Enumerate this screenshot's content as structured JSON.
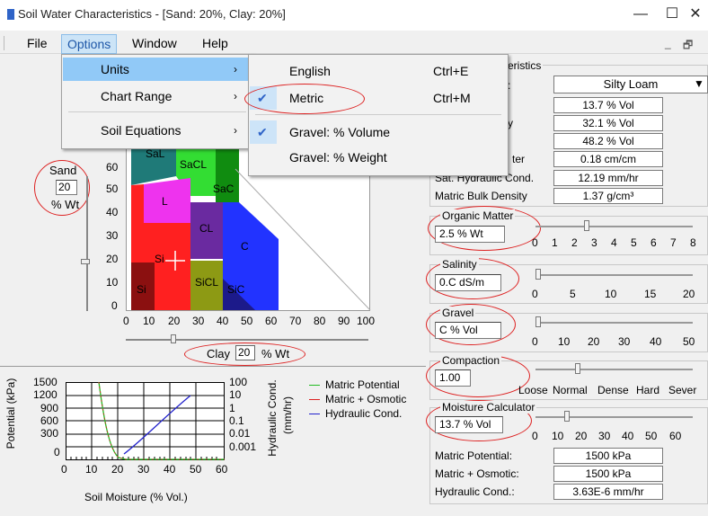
{
  "window": {
    "title": "Soil Water Characteristics  - [Sand: 20%, Clay: 20%]",
    "minimize": "—",
    "maximize": "☐",
    "close": "✕"
  },
  "menubar": {
    "items": [
      "File",
      "Options",
      "Window",
      "Help"
    ],
    "mdi_minimize": "_",
    "mdi_restore": "🗗"
  },
  "options_menu": {
    "items": [
      {
        "label": "Units",
        "arrow": "›"
      },
      {
        "label": "Chart Range",
        "arrow": "›"
      },
      {
        "label": "Soil Equations",
        "arrow": "›"
      }
    ]
  },
  "units_submenu": {
    "items": [
      {
        "label": "English",
        "shortcut": "Ctrl+E",
        "checked": false
      },
      {
        "label": "Metric",
        "shortcut": "Ctrl+M",
        "checked": true
      },
      {
        "label": "Gravel: % Volume",
        "shortcut": "",
        "checked": true
      },
      {
        "label": "Gravel: % Weight",
        "shortcut": "",
        "checked": false
      }
    ],
    "check_mark": "✔"
  },
  "triangle": {
    "sand_label": "Sand",
    "sand_value": "20",
    "sand_unit": "% Wt",
    "y_ticks": [
      "60",
      "50",
      "40",
      "30",
      "20",
      "10",
      "0"
    ],
    "x_ticks": [
      "0",
      "10",
      "20",
      "30",
      "40",
      "50",
      "60",
      "70",
      "80",
      "90",
      "100"
    ],
    "clay_label": "Clay",
    "clay_value": "20",
    "clay_unit": "% Wt",
    "region_labels": [
      "SaL",
      "SaCL",
      "L",
      "SaC",
      "CL",
      "C",
      "Si",
      "SiCL",
      "Si",
      "SiC"
    ],
    "region_colors": {
      "SaL": "#1f7a78",
      "SaCL": "#33dd33",
      "SaC": "#108c10",
      "L": "#ee33ee",
      "CL": "#6a2aa0",
      "C": "#2233ff",
      "Si": "#ff2020",
      "SiCL": "#8d9a14",
      "SiC": "#1c1a8a",
      "SiLow": "#8b1010"
    }
  },
  "properties": {
    "heading_fragment": "eristics",
    "texture": "Silty Loam",
    "rows": [
      {
        "label": "",
        "value": "13.7 % Vol"
      },
      {
        "label": "",
        "value": "32.1 % Vol"
      },
      {
        "label": "",
        "value": "48.2 % Vol"
      },
      {
        "label": "ter",
        "value": "0.18 cm/cm"
      },
      {
        "label": "Sat. Hydraulic Cond.",
        "value": "12.19 mm/hr"
      },
      {
        "label": "Matric Bulk Density",
        "value": "1.37 g/cm³"
      }
    ],
    "partial_labels": [
      ":",
      "y"
    ]
  },
  "organic": {
    "title": "Organic Matter",
    "value": "2.5 % Wt",
    "ticks": [
      "0",
      "1",
      "2",
      "3",
      "4",
      "5",
      "6",
      "7",
      "8"
    ]
  },
  "salinity": {
    "title": "Salinity",
    "value": "0.C dS/m",
    "ticks": [
      "0",
      "5",
      "10",
      "15",
      "20"
    ]
  },
  "gravel": {
    "title": "Gravel",
    "value": "C % Vol",
    "ticks": [
      "0",
      "10",
      "20",
      "30",
      "40",
      "50"
    ]
  },
  "compaction": {
    "title": "Compaction",
    "value": "1.00",
    "ticks": [
      "Loose",
      "Normal",
      "Dense",
      "Hard",
      "Sever"
    ]
  },
  "moisture": {
    "title": "Moisture Calculator",
    "value": "13.7 % Vol",
    "ticks": [
      "0",
      "10",
      "20",
      "30",
      "40",
      "50",
      "60"
    ],
    "results": [
      {
        "label": "Matric Potential:",
        "value": "1500 kPa"
      },
      {
        "label": "Matric + Osmotic:",
        "value": "1500 kPa"
      },
      {
        "label": "Hydraulic Cond.:",
        "value": "3.63E-6 mm/hr"
      }
    ]
  },
  "mini_chart": {
    "y_left_label": "Potential (kPa)",
    "y_left_ticks": [
      "1500",
      "1200",
      "900",
      "600",
      "300",
      "0"
    ],
    "y_right_label": "Hydraulic Cond.",
    "y_right_unit": "(mm/hr)",
    "y_right_ticks": [
      "100",
      "10",
      "1",
      "0.1",
      "0.01",
      "0.001"
    ],
    "x_ticks": [
      "0",
      "10",
      "20",
      "30",
      "40",
      "50",
      "60"
    ],
    "x_label": "Soil Moisture (% Vol.)",
    "legend": [
      {
        "name": "Matric Potential",
        "color": "#22bb22"
      },
      {
        "name": "Matric + Osmotic",
        "color": "#dd2222"
      },
      {
        "name": "Hydraulic Cond.",
        "color": "#2222cc"
      }
    ]
  }
}
